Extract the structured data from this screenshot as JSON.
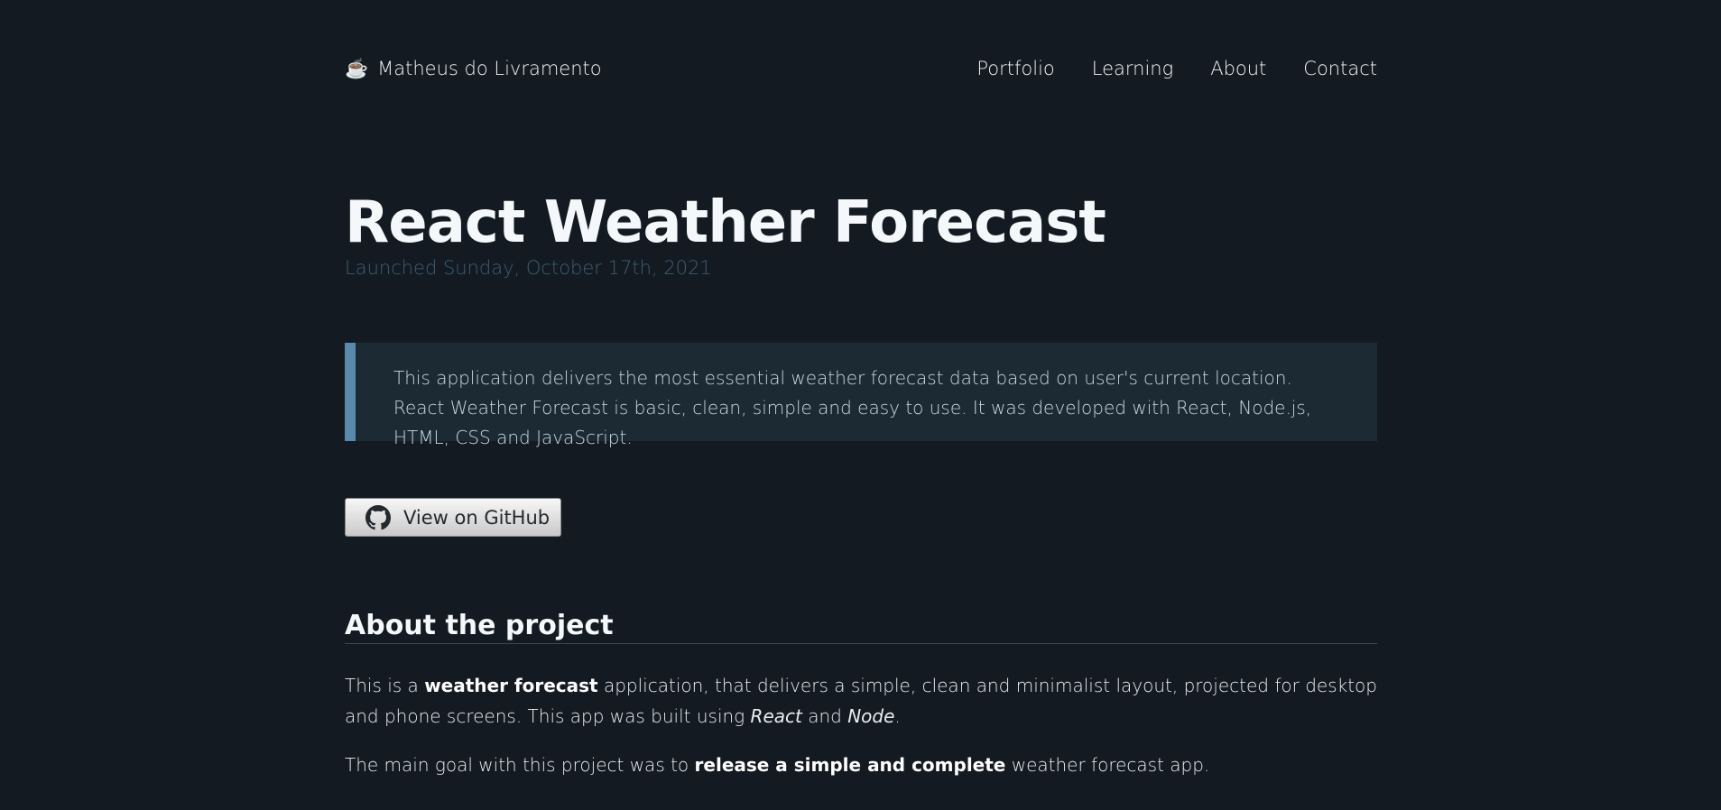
{
  "header": {
    "brand_icon": "coffee-icon",
    "brand_glyph": "☕",
    "brand_name": "Matheus do Livramento",
    "nav": [
      "Portfolio",
      "Learning",
      "About",
      "Contact"
    ]
  },
  "project": {
    "title": "React Weather Forecast",
    "launched": "Launched Sunday, October 17th, 2021",
    "summary": "This application delivers the most essential weather forecast data based on user's current location. React Weather Forecast is basic, clean, simple and easy to use. It was developed with React, Node.js, HTML, CSS and JavaScript.",
    "github_button": "View on GitHub",
    "github_icon": "github-icon"
  },
  "about": {
    "heading": "About the project",
    "p1": {
      "t1": "This is a ",
      "b1": "weather forecast",
      "t2": " application, that delivers a simple, clean and minimalist layout, projected for desktop and phone screens. This app was built using ",
      "i1": "React",
      "t3": " and ",
      "i2": "Node",
      "t4": "."
    },
    "p2": {
      "t1": "The main goal with this project was to ",
      "b1": "release a simple and complete",
      "t2": " weather forecast app."
    }
  },
  "colors": {
    "background": "#131a21",
    "callout_bg": "#1b2a33",
    "callout_border": "#5a8aab",
    "launched_text": "#3e5d72"
  }
}
